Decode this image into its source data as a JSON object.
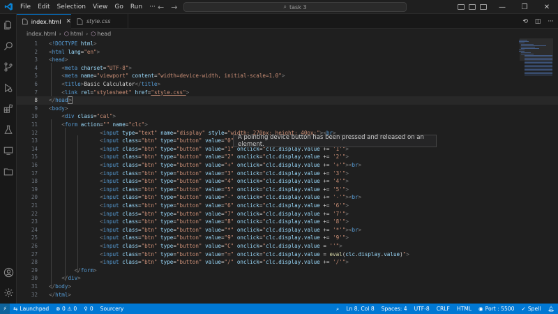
{
  "titlebar": {
    "menu": [
      "File",
      "Edit",
      "Selection",
      "View",
      "Go",
      "Run",
      "···"
    ],
    "search": "task 3",
    "window_controls": [
      "—",
      "❐",
      "✕"
    ]
  },
  "activity_bar": {
    "items": [
      "explorer-icon",
      "search-icon",
      "source-control-icon",
      "run-debug-icon",
      "extensions-icon",
      "testing-icon",
      "remote-explorer-icon",
      "folder-icon"
    ],
    "bottom": [
      "account-icon",
      "settings-gear-icon"
    ]
  },
  "tabs": [
    {
      "label": "index.html",
      "active": true
    },
    {
      "label": "style.css",
      "active": false
    }
  ],
  "breadcrumb": [
    "index.html",
    "html",
    "head"
  ],
  "editor": {
    "current_line": 8,
    "tooltip": "A pointing device button has been pressed and released on an element."
  },
  "statusbar": {
    "remote": "⚡",
    "launchpad": "Launchpad",
    "problems": "⊗ 0 ⚠ 0",
    "ports": "0",
    "branch": "Sourcery",
    "cursor": "Ln 8, Col 8",
    "spaces": "Spaces: 4",
    "encoding": "UTF-8",
    "eol": "CRLF",
    "language": "HTML",
    "port": "Port : 5500",
    "spell": "Spell"
  },
  "colors": {
    "accent": "#0078d4",
    "tag": "#569cd6",
    "attribute": "#9cdcfe",
    "string": "#ce9178"
  }
}
